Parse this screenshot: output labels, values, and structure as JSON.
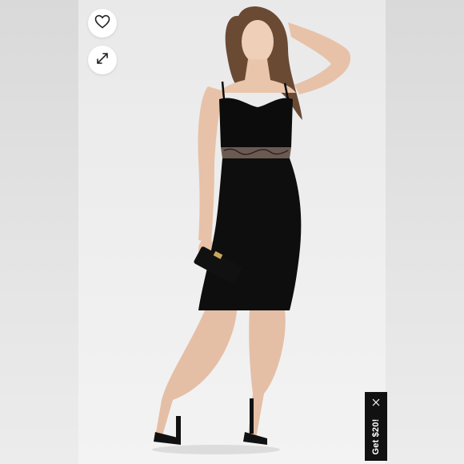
{
  "product_image": {
    "alt": "",
    "colors": {
      "dress": "#0c0c0c",
      "backdrop": "#ececec",
      "side_panels": "#dedede"
    }
  },
  "actions": {
    "like_icon": "heart-icon",
    "expand_icon": "expand-arrows-icon"
  },
  "promo": {
    "label": "Get $20!",
    "close_icon": "close-icon",
    "background": "#111111",
    "text_color": "#ffffff"
  }
}
